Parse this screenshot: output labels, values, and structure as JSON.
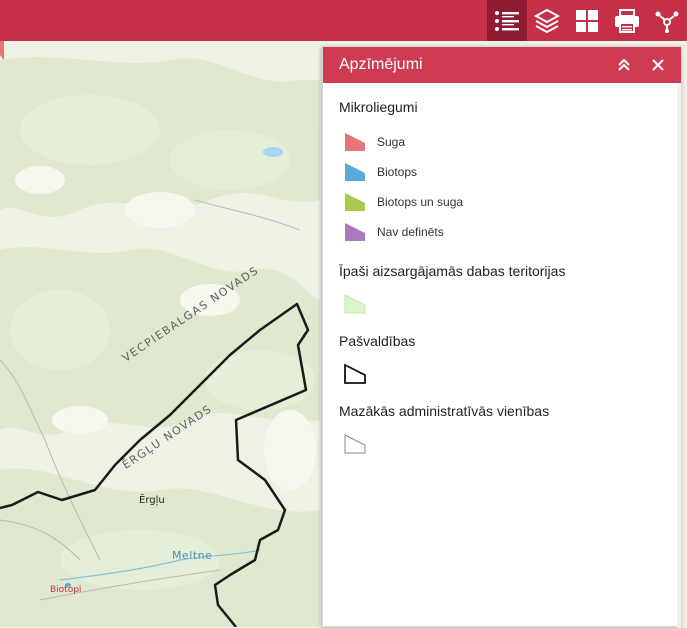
{
  "toolbar": {
    "tools": [
      {
        "name": "legend-icon",
        "active": true
      },
      {
        "name": "layers-icon",
        "active": false
      },
      {
        "name": "basemap-gallery-icon",
        "active": false
      },
      {
        "name": "print-icon",
        "active": false
      },
      {
        "name": "share-icon",
        "active": false
      }
    ],
    "colors": {
      "bar": "#c62f48",
      "active": "#8e1b30",
      "icon": "#ffffff"
    }
  },
  "map": {
    "labels": {
      "municipality_1": "VECPIEBALGAS NOVADS",
      "municipality_2": "ĒRGĻU NOVADS",
      "town": "Ērgļu",
      "river": "Meltne",
      "place": "Biotopi"
    }
  },
  "legend": {
    "title": "Apzīmējumi",
    "groups": [
      {
        "title": "Mikroliegumi",
        "items": [
          {
            "label": "Suga",
            "color": "#e87575"
          },
          {
            "label": "Biotops",
            "color": "#5aabd8"
          },
          {
            "label": "Biotops un suga",
            "color": "#a8c94a"
          },
          {
            "label": "Nav definēts",
            "color": "#a97bbe"
          }
        ]
      },
      {
        "title": "Īpaši aizsargājamās dabas teritorijas",
        "swatch_color": "#dcf5c8"
      },
      {
        "title": "Pašvaldības",
        "swatch_stroke": "#111111"
      },
      {
        "title": "Mazākās administratīvās vienības",
        "swatch_stroke": "#888888"
      }
    ]
  }
}
